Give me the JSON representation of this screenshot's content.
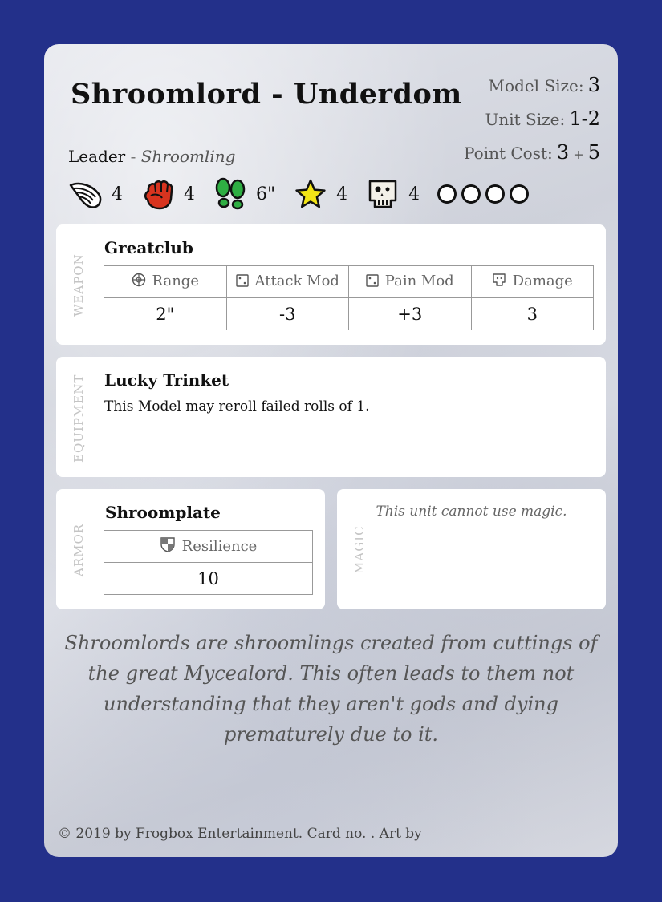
{
  "card": {
    "title": "Shroomlord - Underdom",
    "model_size_label": "Model Size:",
    "model_size": "3",
    "unit_size_label": "Unit Size:",
    "unit_size": "1-2",
    "point_cost_label": "Point Cost:",
    "point_cost_base": "3",
    "point_cost_plus": "+",
    "point_cost_extra": "5",
    "role": "Leader",
    "role_separator": "-",
    "unit_type": "Shroomling"
  },
  "stats": [
    {
      "icon": "wing-icon",
      "value": "4"
    },
    {
      "icon": "fist-icon",
      "value": "4"
    },
    {
      "icon": "footprints-icon",
      "value": "6\""
    },
    {
      "icon": "star-icon",
      "value": "4"
    },
    {
      "icon": "skull-icon",
      "value": "4"
    }
  ],
  "wound_circles": 4,
  "weapon": {
    "side_label": "WEAPON",
    "name": "Greatclub",
    "headers": [
      {
        "icon": "crosshair-icon",
        "label": "Range"
      },
      {
        "icon": "dice-icon",
        "label": "Attack Mod"
      },
      {
        "icon": "dice-icon",
        "label": "Pain Mod"
      },
      {
        "icon": "skull-icon",
        "label": "Damage"
      }
    ],
    "values": [
      "2\"",
      "-3",
      "+3",
      "3"
    ]
  },
  "equipment": {
    "side_label": "EQUIPMENT",
    "name": "Lucky Trinket",
    "text": "This Model may reroll failed rolls of 1."
  },
  "armor": {
    "side_label": "ARMOR",
    "name": "Shroomplate",
    "header": {
      "icon": "shield-icon",
      "label": "Resilience"
    },
    "value": "10"
  },
  "magic": {
    "side_label": "MAGIC",
    "text": "This unit cannot use magic."
  },
  "flavor": "Shroomlords are shroomlings created from cuttings of the great Mycealord. This often leads to them not understanding that they aren't gods and dying prematurely due to it.",
  "footer": "© 2019 by Frogbox Entertainment. Card no. . Art by",
  "colors": {
    "background": "#23308a",
    "fist": "#d8341f",
    "footprints": "#2fae43",
    "star": "#f2e416"
  }
}
